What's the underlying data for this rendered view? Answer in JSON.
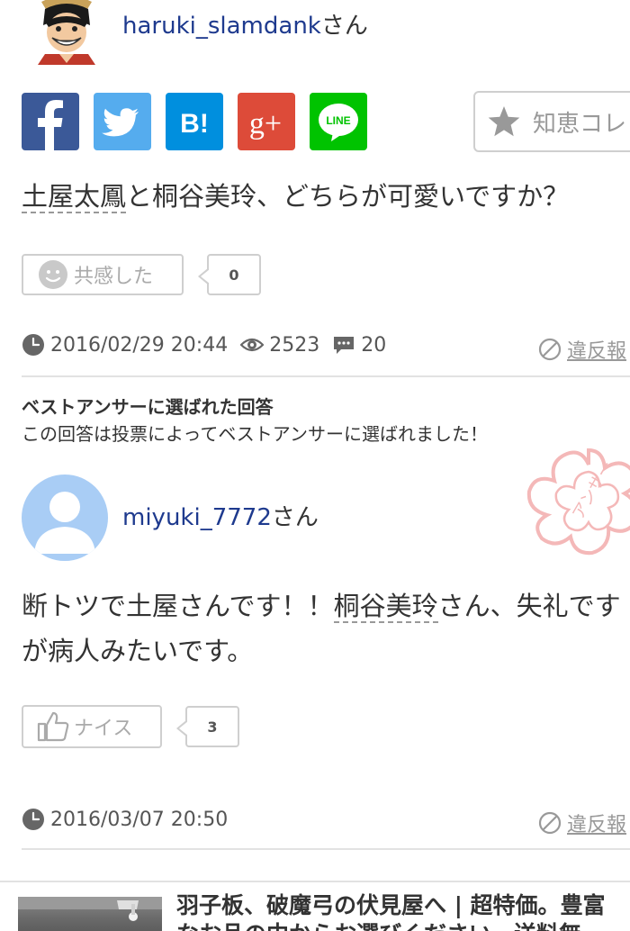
{
  "asker": {
    "name": "haruki_slamdank",
    "suffix": "さん"
  },
  "share": {
    "facebook_icon": "facebook-icon",
    "twitter_icon": "twitter-icon",
    "hatena_label": "B!",
    "google_plus_label": "g+",
    "line_label": "LINE"
  },
  "chiebukuro_collection": {
    "label": "知恵コレ"
  },
  "question": {
    "keyword": "土屋太鳳",
    "rest": "と桐谷美玲、どちらが可愛いですか？"
  },
  "empathy": {
    "label": "共感した",
    "count": "0"
  },
  "question_meta": {
    "datetime": "2016/02/29 20:44",
    "views": "2523",
    "answers": "20",
    "report_label": "違反報"
  },
  "best_answer": {
    "title": "ベストアンサーに選ばれた回答",
    "subtitle": "この回答は投票によってベストアンサーに選ばれました！",
    "stamp_text": "アンサー"
  },
  "answerer": {
    "name": "miyuki_7772",
    "suffix": "さん"
  },
  "answer": {
    "part1": "断トツで土屋さんです！！",
    "keyword": "桐谷美玲",
    "part2": "さん、失礼ですが病人みたいです。"
  },
  "nice": {
    "label": "ナイス",
    "count": "3"
  },
  "answer_meta": {
    "datetime": "2016/03/07 20:50",
    "report_label": "違反報"
  },
  "ad": {
    "line1": "羽子板、破魔弓の伏見屋へ | 超特価。豊富",
    "line2": "なお品の中からお選びください。送料無"
  }
}
